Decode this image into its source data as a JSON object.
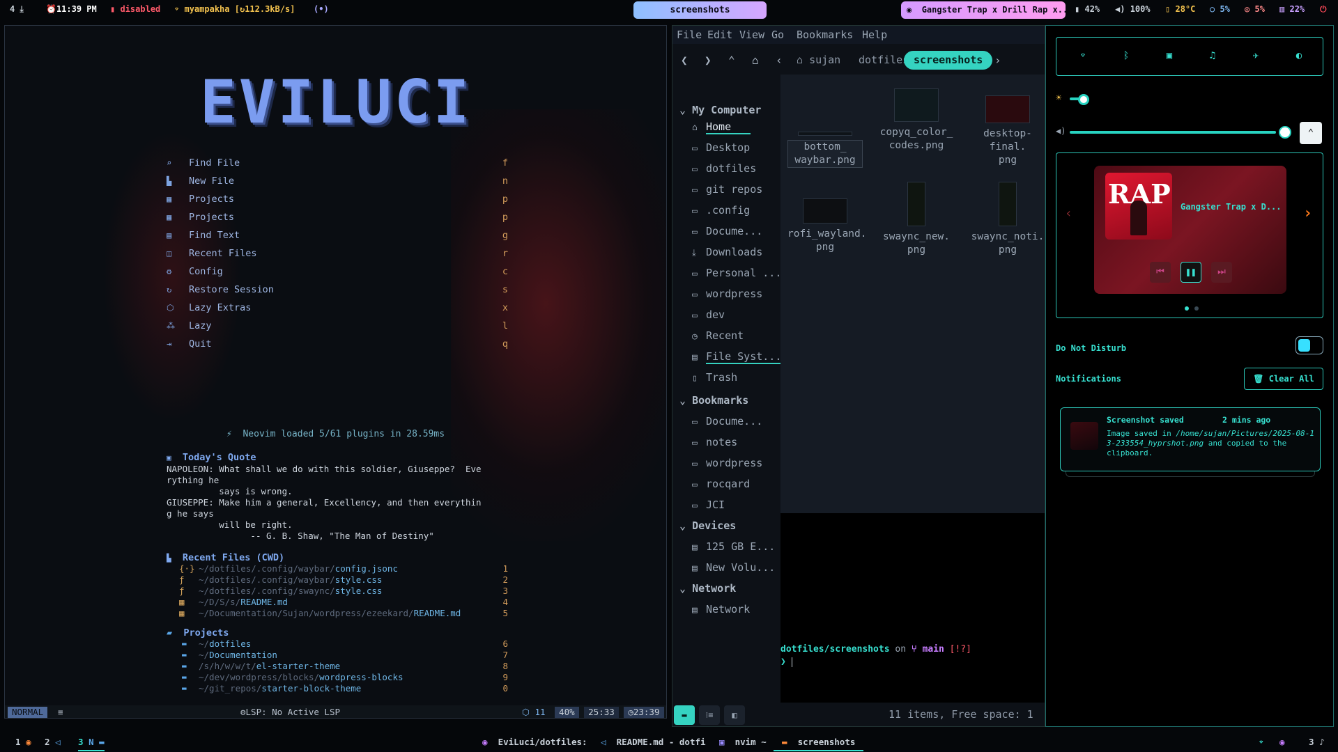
{
  "topbar": {
    "workspace_num": "4",
    "time": "11:39 PM",
    "disabled": "disabled",
    "network": "myampakha [",
    "net_speed": "112.3kB/s]",
    "center_label": "screenshots",
    "music": "Gangster Trap x Drill Rap x...",
    "battery": "42%",
    "volume": "100%",
    "temp": "28°C",
    "cpu": "5%",
    "mem": "5%",
    "disk": "22%",
    "colors": {
      "accent": "#37e0d0",
      "red": "#ff5a6a",
      "blue": "#7b9cf0"
    }
  },
  "nvim": {
    "logo": "EVILUCI",
    "menu": [
      {
        "icon": "search-icon",
        "label": "Find File",
        "key": "f"
      },
      {
        "icon": "file-icon",
        "label": "New File",
        "key": "n"
      },
      {
        "icon": "project-icon",
        "label": "Projects",
        "key": "p"
      },
      {
        "icon": "project-icon",
        "label": "Projects",
        "key": "p"
      },
      {
        "icon": "text-icon",
        "label": "Find Text",
        "key": "g"
      },
      {
        "icon": "recent-icon",
        "label": "Recent Files",
        "key": "r"
      },
      {
        "icon": "gear-icon",
        "label": "Config",
        "key": "c"
      },
      {
        "icon": "restore-icon",
        "label": "Restore Session",
        "key": "s"
      },
      {
        "icon": "lazy-extras-icon",
        "label": "Lazy Extras",
        "key": "x"
      },
      {
        "icon": "lazy-icon",
        "label": "Lazy",
        "key": "l"
      },
      {
        "icon": "quit-icon",
        "label": "Quit",
        "key": "q"
      }
    ],
    "loaded": "Neovim loaded 5/61 plugins in 28.59ms",
    "quote_title": "Today's Quote",
    "quote": "NAPOLEON: What shall we do with this soldier, Giuseppe?  Eve\nrything he\n          says is wrong.\nGIUSEPPE: Make him a general, Excellency, and then everythin\ng he says\n          will be right.\n                -- G. B. Shaw, \"The Man of Destiny\"",
    "recent_title": "Recent Files (CWD)",
    "recent_files": [
      {
        "dir": "~/dotfiles/.config/waybar/",
        "file": "config.jsonc",
        "num": "1"
      },
      {
        "dir": "~/dotfiles/.config/waybar/",
        "file": "style.css",
        "num": "2"
      },
      {
        "dir": "~/dotfiles/.config/swaync/",
        "file": "style.css",
        "num": "3"
      },
      {
        "dir": "~/D/S/s/",
        "file": "README.md",
        "num": "4"
      },
      {
        "dir": "~/Documentation/Sujan/wordpress/ezeekard/",
        "file": "README.md",
        "num": "5"
      }
    ],
    "projects_title": "Projects",
    "projects": [
      {
        "dir": "~/",
        "name": "dotfiles",
        "num": "6"
      },
      {
        "dir": "~/",
        "name": "Documentation",
        "num": "7"
      },
      {
        "dir": "/s/h/w/w/t/",
        "name": "el-starter-theme",
        "num": "8"
      },
      {
        "dir": "~/dev/wordpress/blocks/",
        "name": "wordpress-blocks",
        "num": "9"
      },
      {
        "dir": "~/git_repos/",
        "name": "starter-block-theme",
        "num": "0"
      }
    ],
    "status": {
      "mode": "NORMAL",
      "lsp": "LSP: No Active LSP",
      "diag": "11",
      "percent": "40%",
      "pos": "25:33",
      "clock": "23:39"
    }
  },
  "filemanager": {
    "menus": [
      "File",
      "Edit",
      "View",
      "Go",
      "Bookmarks",
      "Help"
    ],
    "crumbs": [
      "sujan",
      "dotfiles"
    ],
    "crumb_active": "screenshots",
    "my_computer": "My Computer",
    "places": [
      {
        "icon": "home-icon",
        "label": "Home"
      },
      {
        "icon": "folder-icon",
        "label": "Desktop"
      },
      {
        "icon": "folder-icon",
        "label": "dotfiles"
      },
      {
        "icon": "folder-icon",
        "label": "git repos"
      },
      {
        "icon": "folder-icon",
        "label": ".config"
      },
      {
        "icon": "folder-icon",
        "label": "Docume..."
      },
      {
        "icon": "download-icon",
        "label": "Downloads"
      },
      {
        "icon": "folder-icon",
        "label": "Personal ..."
      },
      {
        "icon": "folder-icon",
        "label": "wordpress"
      },
      {
        "icon": "folder-icon",
        "label": "dev"
      },
      {
        "icon": "clock-icon",
        "label": "Recent"
      },
      {
        "icon": "drive-icon",
        "label": "File Syst..."
      },
      {
        "icon": "trash-icon",
        "label": "Trash"
      }
    ],
    "bookmarks_title": "Bookmarks",
    "bookmarks": [
      "Docume...",
      "notes",
      "wordpress",
      "rocqard",
      "JCI"
    ],
    "devices_title": "Devices",
    "devices": [
      "125 GB E...",
      "New Volu..."
    ],
    "network_title": "Network",
    "network": [
      "Network"
    ],
    "files": [
      {
        "name1": "bottom_",
        "name2": "waybar.png"
      },
      {
        "name1": "copyq_color_",
        "name2": "codes.png"
      },
      {
        "name1": "desktop-final.",
        "name2": "png"
      },
      {
        "name1": "rofi_wayland.",
        "name2": "png"
      },
      {
        "name1": "swaync_new.",
        "name2": "png"
      },
      {
        "name1": "swaync_noti.",
        "name2": "png"
      }
    ],
    "terminal": {
      "path": "dotfiles/screenshots",
      "on": "on",
      "branch": "main",
      "flags": "[!?]",
      "prompt": "❯"
    },
    "status": "11 items, Free space: 1"
  },
  "panel": {
    "media_title": "Gangster Trap x D...",
    "album_text": "RAP",
    "dnd": "Do Not Disturb",
    "notifications": "Notifications",
    "clear_all": "Clear All",
    "notif": {
      "title": "Screenshot saved",
      "time": "2 mins ago",
      "body_prefix": "Image saved in ",
      "body_path": "/home/sujan/Pictures/2025-08-13-233554_hyprshot.png",
      "body_suffix": " and copied to the clipboard."
    },
    "brightness": 0.06,
    "volume_level": 0.98
  },
  "bottombar": {
    "ws1": "1",
    "ws2": "2",
    "ws3": "3",
    "ws3_label": "N",
    "tasks": [
      "EviLuci/dotfiles:",
      "README.md - dotfi",
      "nvim ~",
      "screenshots"
    ],
    "right_num": "3"
  }
}
